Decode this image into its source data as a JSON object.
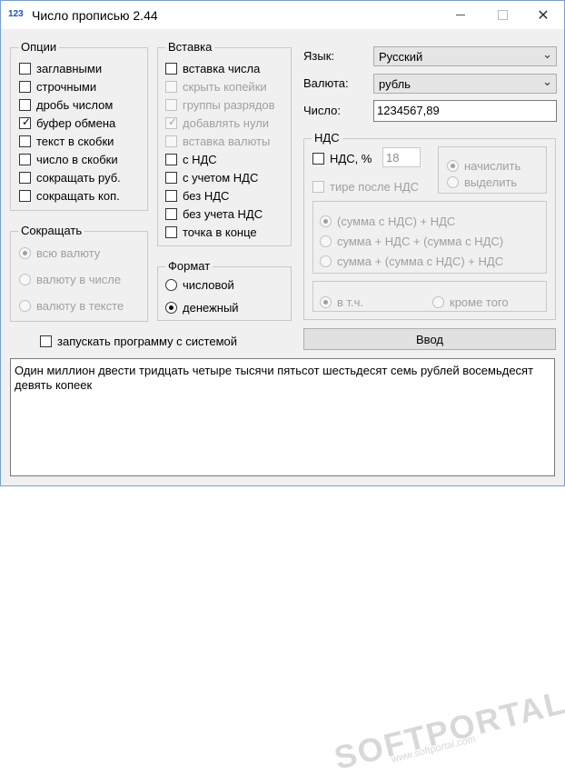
{
  "window": {
    "icon_text": "123",
    "title": "Число прописью 2.44",
    "icons": {
      "min": "minimize-icon",
      "max": "maximize-icon",
      "close": "close-icon"
    }
  },
  "options": {
    "legend": "Опции",
    "items": [
      {
        "label": "заглавными",
        "checked": false
      },
      {
        "label": "строчными",
        "checked": false
      },
      {
        "label": "дробь числом",
        "checked": false
      },
      {
        "label": "буфер обмена",
        "checked": true
      },
      {
        "label": "текст в скобки",
        "checked": false
      },
      {
        "label": "число в скобки",
        "checked": false
      },
      {
        "label": "сокращать руб.",
        "checked": false
      },
      {
        "label": "сокращать коп.",
        "checked": false
      }
    ]
  },
  "insert": {
    "legend": "Вставка",
    "items": [
      {
        "label": "вставка числа",
        "checked": false,
        "disabled": false
      },
      {
        "label": "скрыть копейки",
        "checked": false,
        "disabled": true
      },
      {
        "label": "группы разрядов",
        "checked": false,
        "disabled": true
      },
      {
        "label": "добавлять нули",
        "checked": true,
        "disabled": true
      },
      {
        "label": "вставка валюты",
        "checked": false,
        "disabled": true
      },
      {
        "label": "с НДС",
        "checked": false,
        "disabled": false
      },
      {
        "label": "с учетом НДС",
        "checked": false,
        "disabled": false
      },
      {
        "label": "без НДС",
        "checked": false,
        "disabled": false
      },
      {
        "label": "без учета НДС",
        "checked": false,
        "disabled": false
      },
      {
        "label": "точка в конце",
        "checked": false,
        "disabled": false
      }
    ]
  },
  "shorten": {
    "legend": "Сокращать",
    "items": [
      {
        "label": "всю валюту",
        "selected": true
      },
      {
        "label": "валюту в числе",
        "selected": false
      },
      {
        "label": "валюту в тексте",
        "selected": false
      }
    ]
  },
  "format": {
    "legend": "Формат",
    "items": [
      {
        "label": "числовой",
        "selected": false
      },
      {
        "label": "денежный",
        "selected": true
      }
    ]
  },
  "autostart_label": "запускать программу с системой",
  "fields": {
    "language_label": "Язык:",
    "language_value": "Русский",
    "currency_label": "Валюта:",
    "currency_value": "рубль",
    "number_label": "Число:",
    "number_value": "1234567,89"
  },
  "vat": {
    "legend": "НДС",
    "checkbox_label": "НДС, %",
    "rate": "18",
    "dash_label": "тире после НДС",
    "mode": [
      {
        "label": "начислить",
        "selected": true
      },
      {
        "label": "выделить",
        "selected": false
      }
    ],
    "formulas": [
      {
        "label": "(сумма с НДС) + НДС",
        "selected": true
      },
      {
        "label": "сумма + НДС + (сумма с НДС)",
        "selected": false
      },
      {
        "label": "сумма + (сумма с НДС) + НДС",
        "selected": false
      }
    ],
    "incl": [
      {
        "label": "в т.ч.",
        "selected": true
      },
      {
        "label": "кроме того",
        "selected": false
      }
    ]
  },
  "enter_button": "Ввод",
  "output_text": "Один миллион двести тридцать четыре тысячи пятьсот шестьдесят семь рублей восемьдесят девять копеек",
  "watermark": {
    "brand": "SOFTPORTAL",
    "url": "www.softportal.com"
  }
}
